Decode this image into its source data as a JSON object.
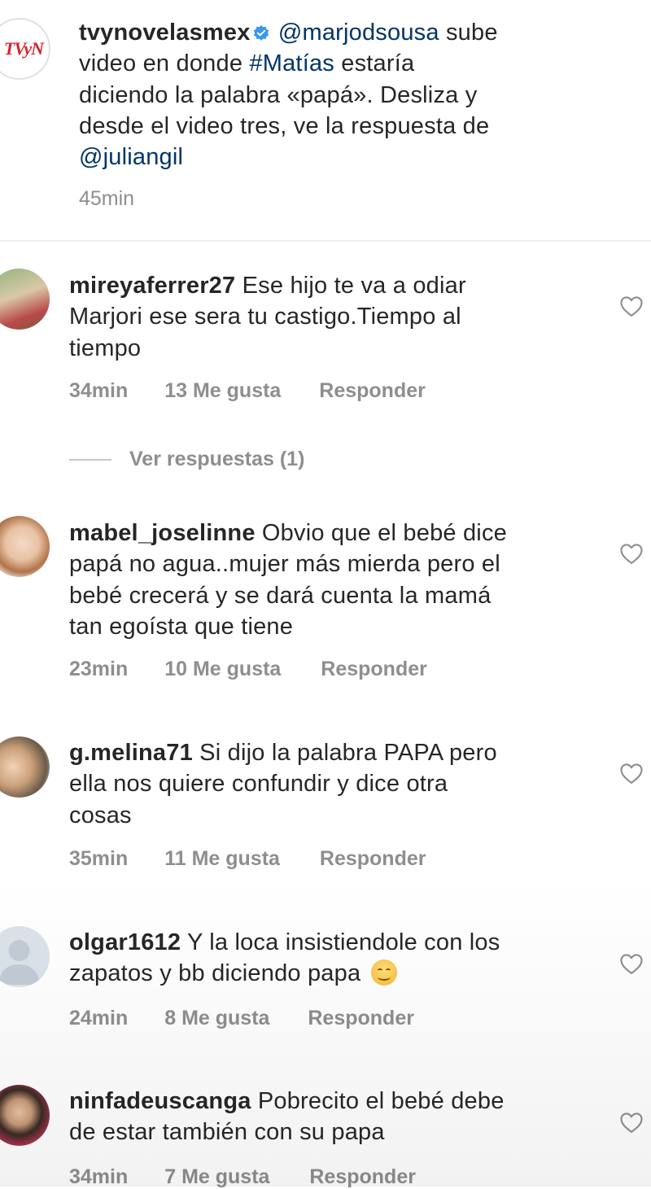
{
  "caption": {
    "username": "tvynovelasmex",
    "mention": "@marjodsousa",
    "line1_rest": "sube",
    "line2_pre": "video en donde",
    "hashtag": "#Matías",
    "line2_post": "estaría",
    "line3": "diciendo la palabra «papá». Desliza y",
    "line4": "desde el video tres, ve la respuesta de",
    "line5_mention": "@juliangil",
    "time": "45min",
    "logo_text": "TVyN"
  },
  "comments": [
    {
      "username": "mireyaferrer27",
      "first": "Ese hijo te va a odiar",
      "lines": [
        "Marjori ese sera tu castigo.Tiempo al",
        "tiempo"
      ],
      "time": "34min",
      "likes": "13 Me gusta",
      "reply": "Responder"
    },
    {
      "username": "mabel_joselinne",
      "first": "Obvio que el bebé dice",
      "lines": [
        "papá no agua..mujer más mierda pero el",
        "bebé crecerá y se dará cuenta la mamá",
        "tan egoísta que tiene"
      ],
      "time": "23min",
      "likes": "10 Me gusta",
      "reply": "Responder"
    },
    {
      "username": "g.melina71",
      "first": "Si dijo la palabra PAPA pero",
      "lines": [
        "ella nos quiere confundir y dice otra",
        "cosas"
      ],
      "time": "35min",
      "likes": "11 Me gusta",
      "reply": "Responder"
    },
    {
      "username": "olgar1612",
      "first": "Y la loca insistiendole con los",
      "lines": [
        "zapatos y bb diciendo papa"
      ],
      "time": "24min",
      "likes": "8 Me gusta",
      "reply": "Responder"
    },
    {
      "username": "ninfadeuscanga",
      "first": "Pobrecito el bebé debe",
      "lines": [
        "de estar también con su papa"
      ],
      "time": "34min",
      "likes": "7 Me gusta",
      "reply": "Responder"
    }
  ],
  "view_replies": "Ver respuestas (1)",
  "colors": {
    "link": "#003569",
    "verified": "#3897f0",
    "muted": "#8e8e8e",
    "logo": "#d8232a"
  },
  "icons": [
    "verified-badge-icon",
    "heart-outline-icon",
    "smiling-face-emoji"
  ]
}
